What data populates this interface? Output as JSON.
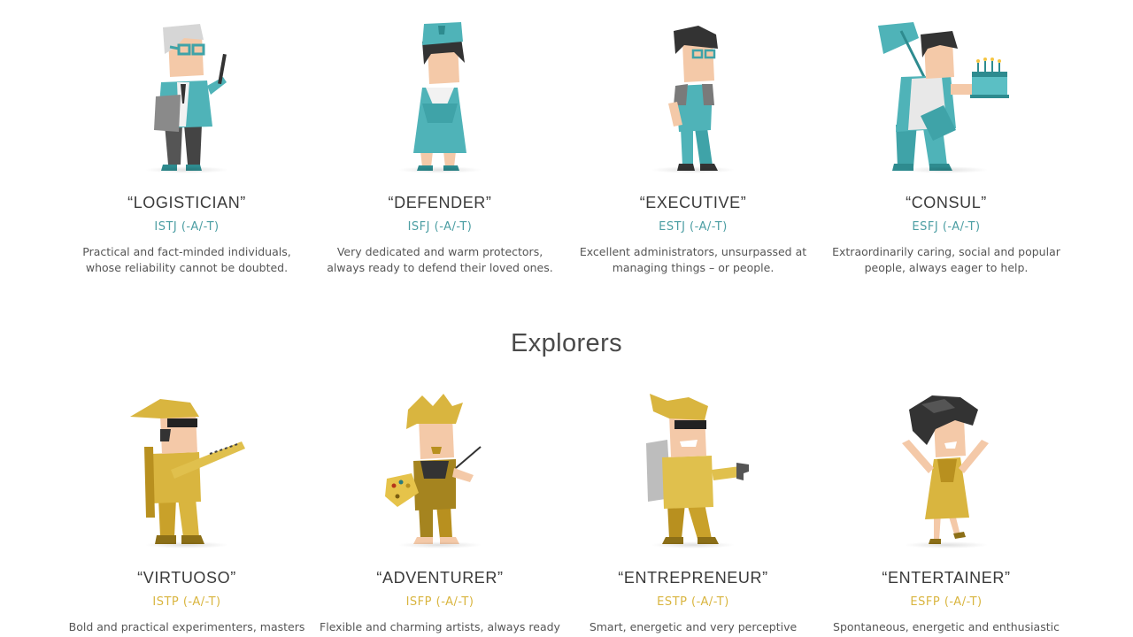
{
  "colors": {
    "sentinel_accent": "#4c9ea3",
    "explorer_accent": "#d9b53f",
    "heading": "#4a4a4a"
  },
  "sentinels": [
    {
      "name": "“LOGISTICIAN”",
      "code": "ISTJ (-A/-T)",
      "desc": "Practical and fact-minded individuals, whose reliability cannot be doubted.",
      "icon": "logistician-icon"
    },
    {
      "name": "“DEFENDER”",
      "code": "ISFJ (-A/-T)",
      "desc": "Very dedicated and warm protectors, always ready to defend their loved ones.",
      "icon": "defender-icon"
    },
    {
      "name": "“EXECUTIVE”",
      "code": "ESTJ (-A/-T)",
      "desc": "Excellent administrators, unsurpassed at managing things – or people.",
      "icon": "executive-icon"
    },
    {
      "name": "“CONSUL”",
      "code": "ESFJ (-A/-T)",
      "desc": "Extraordinarily caring, social and popular people, always eager to help.",
      "icon": "consul-icon"
    }
  ],
  "explorers_title": "Explorers",
  "explorers": [
    {
      "name": "“VIRTUOSO”",
      "code": "ISTP (-A/-T)",
      "desc": "Bold and practical experimenters, masters",
      "icon": "virtuoso-icon"
    },
    {
      "name": "“ADVENTURER”",
      "code": "ISFP (-A/-T)",
      "desc": "Flexible and charming artists, always ready",
      "icon": "adventurer-icon"
    },
    {
      "name": "“ENTREPRENEUR”",
      "code": "ESTP (-A/-T)",
      "desc": "Smart, energetic and very perceptive",
      "icon": "entrepreneur-icon"
    },
    {
      "name": "“ENTERTAINER”",
      "code": "ESFP (-A/-T)",
      "desc": "Spontaneous, energetic and enthusiastic",
      "icon": "entertainer-icon"
    }
  ]
}
